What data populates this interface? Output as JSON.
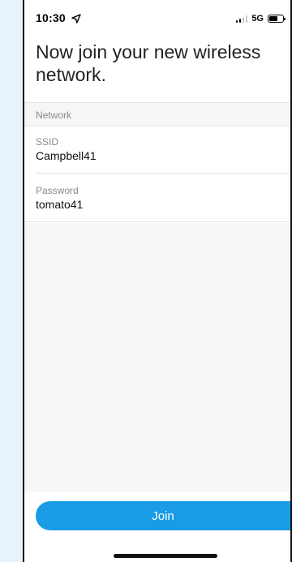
{
  "status_bar": {
    "time": "10:30",
    "network_type": "5G",
    "location_icon": "location-arrow-icon",
    "signal_icon": "cellular-signal-icon",
    "battery_icon": "battery-icon"
  },
  "page": {
    "title": "Now join your new wireless network."
  },
  "network_section": {
    "header": "Network",
    "ssid": {
      "label": "SSID",
      "value": "Campbell41"
    },
    "password": {
      "label": "Password",
      "value": "tomato41"
    }
  },
  "actions": {
    "join_label": "Join"
  },
  "colors": {
    "accent": "#1a9be6",
    "background": "#e8f3fb",
    "section_bg": "#f6f6f6"
  }
}
